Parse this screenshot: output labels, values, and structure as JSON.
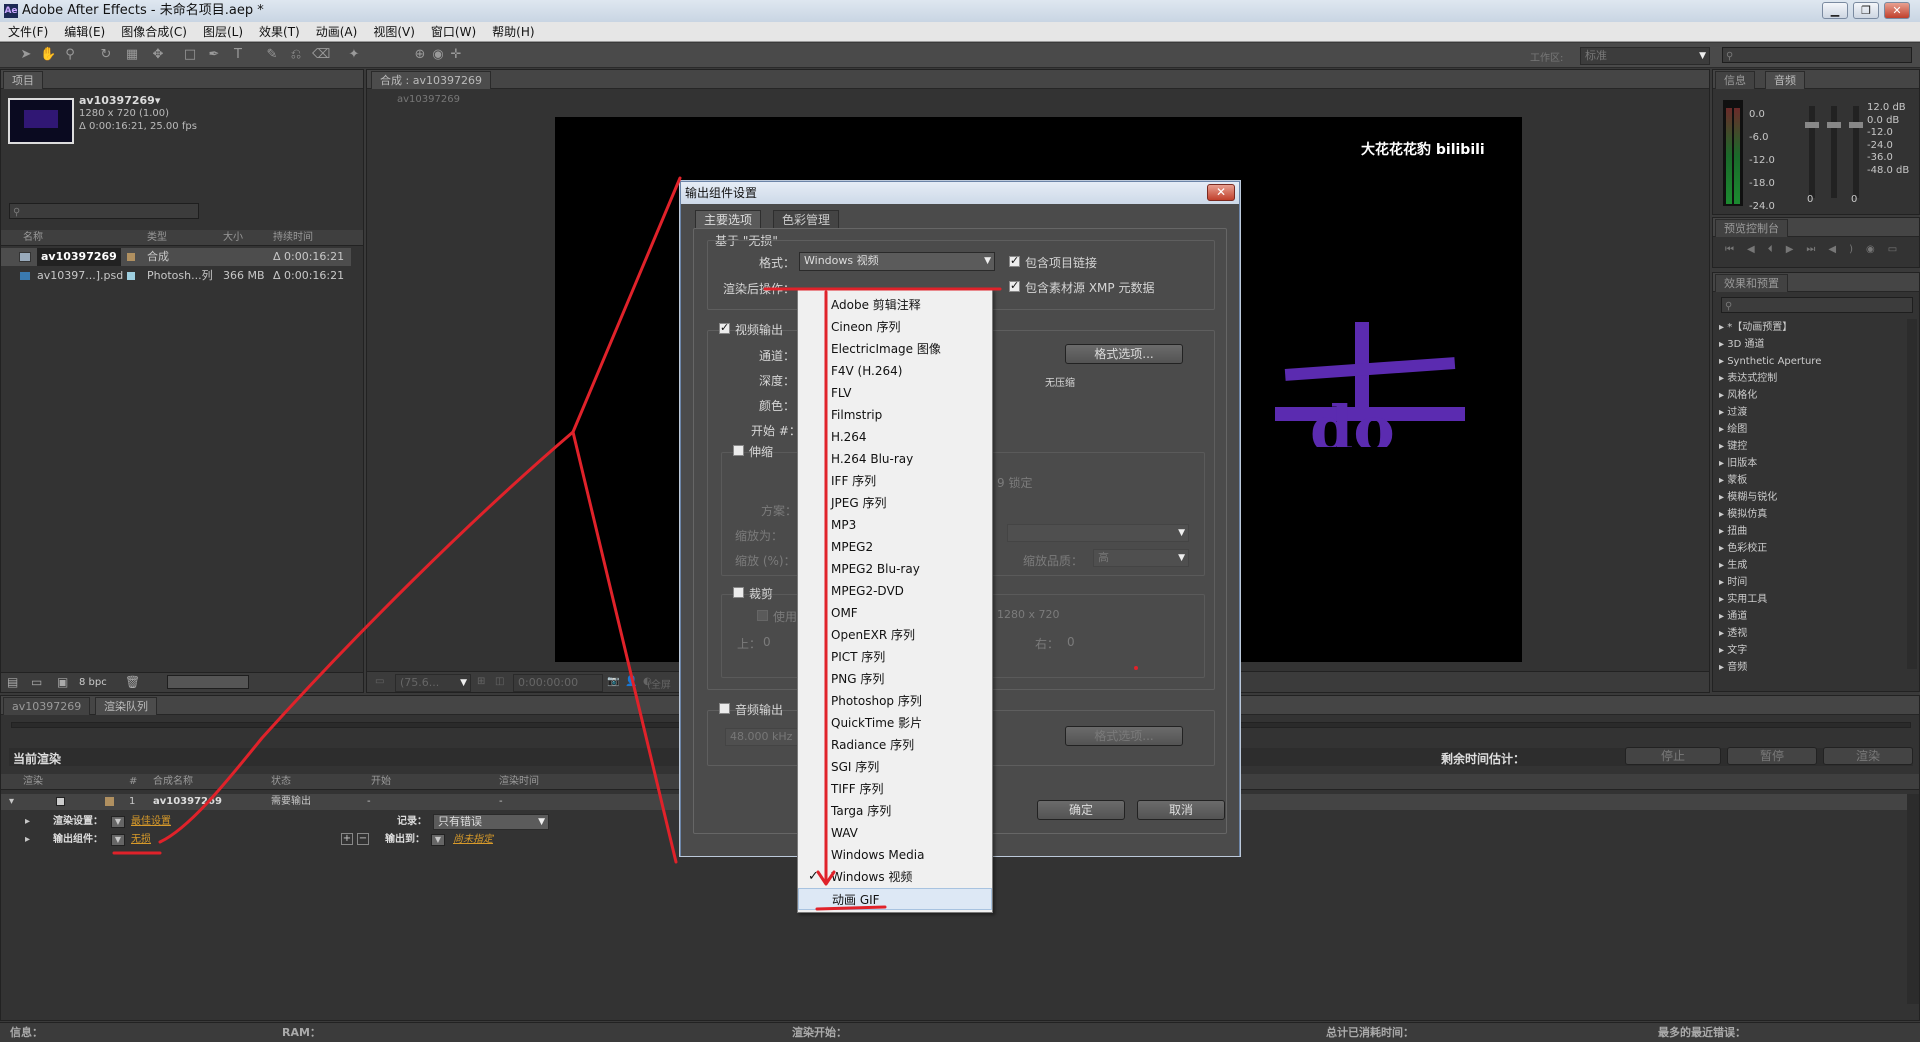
{
  "window": {
    "title": "Adobe After Effects - 未命名项目.aep *"
  },
  "menu": [
    "文件(F)",
    "编辑(E)",
    "图像合成(C)",
    "图层(L)",
    "效果(T)",
    "动画(A)",
    "视图(V)",
    "窗口(W)",
    "帮助(H)"
  ],
  "toolbar": {
    "workspace_label": "工作区:",
    "workspace_value": "标准"
  },
  "project_panel": {
    "tab": "项目",
    "item_name": "av10397269▾",
    "item_size": "1280 x 720 (1.00)",
    "item_duration": "Δ 0:00:16:21, 25.00 fps",
    "columns": [
      "名称",
      "类型",
      "大小",
      "持续时间"
    ],
    "rows": [
      {
        "name": "av10397269",
        "type": "合成",
        "size": "",
        "duration": "Δ 0:00:16:21"
      },
      {
        "name": "av10397...].psd",
        "type": "Photosh...列",
        "size": "366 MB",
        "duration": "Δ 0:00:16:21"
      }
    ],
    "bpc": "8 bpc"
  },
  "comp_panel": {
    "tab": "合成 : av10397269",
    "crumb": "av10397269",
    "watermark": "大花花花豹 bilibili",
    "zoom": "(75.6...",
    "timecode": "0:00:00:00",
    "view_label": "(全屏"
  },
  "info_panel": {
    "tabs": [
      "信息",
      "音频"
    ],
    "db_left": [
      "0.0",
      "-6.0",
      "-12.0",
      "-18.0",
      "-24.0"
    ],
    "db_right": [
      "12.0 dB",
      "0.0 dB",
      "-12.0",
      "-24.0",
      "-36.0",
      "-48.0 dB"
    ],
    "slider_bottom": [
      "0",
      "0"
    ]
  },
  "preview_panel": {
    "tab": "预览控制台"
  },
  "effects_panel": {
    "tab": "效果和预置",
    "items": [
      "*【动画预置】",
      "3D 通道",
      "Synthetic Aperture",
      "表达式控制",
      "风格化",
      "过渡",
      "绘图",
      "键控",
      "旧版本",
      "蒙板",
      "模糊与锐化",
      "模拟仿真",
      "扭曲",
      "色彩校正",
      "生成",
      "时间",
      "实用工具",
      "通道",
      "透视",
      "文字",
      "音频"
    ]
  },
  "render_queue": {
    "tabs": [
      "av10397269",
      "渲染队列"
    ],
    "current_render": "当前渲染",
    "remaining": "剩余时间估计：",
    "buttons": [
      "停止",
      "暂停",
      "渲染"
    ],
    "columns": [
      "渲染",
      "#",
      "合成名称",
      "状态",
      "开始",
      "渲染时间"
    ],
    "row": {
      "num": "1",
      "name": "av10397269",
      "status": "需要输出",
      "start": "-",
      "time": "-"
    },
    "render_settings_label": "渲染设置：",
    "render_settings_value": "最佳设置",
    "log_label": "记录：",
    "log_value": "只有错误",
    "output_module_label": "输出组件：",
    "output_module_value": "无损",
    "output_to_label": "输出到：",
    "output_to_value": "尚未指定"
  },
  "status_bar": {
    "info": "信息：",
    "ram": "RAM：",
    "render_start": "渲染开始：",
    "total_time": "总计已消耗时间：",
    "recent_error": "最多的最近错误："
  },
  "dialog": {
    "title": "输出组件设置",
    "tabs": [
      "主要选项",
      "色彩管理"
    ],
    "based_on": "基于 \"无损\"",
    "format_label": "格式：",
    "format_value": "Windows 视频",
    "post_render_label": "渲染后操作：",
    "include_project_link": "包含项目链接",
    "include_xmp": "包含素材源 XMP 元数据",
    "video_output": "视频输出",
    "channels_label": "通道：",
    "depth_label": "深度：",
    "color_label": "颜色：",
    "start_label": "开始 #：",
    "format_options": "格式选项...",
    "no_compress": "无压缩",
    "stretch": "伸缩",
    "method_label": "方案：",
    "stretch_to_label": "缩放为：",
    "stretch_pct_label": "缩放 (%)：",
    "lock_label": "9 锁定",
    "quality_label": "缩放品质：",
    "quality_value": "高",
    "crop": "裁剪",
    "use_label": "使用",
    "crop_size": "1280 x 720",
    "top_label": "上：",
    "top_value": "0",
    "right_label": "右：",
    "right_value": "0",
    "audio_output": "音频输出",
    "audio_rate": "48.000 kHz",
    "audio_format_options": "格式选项...",
    "ok": "确定",
    "cancel": "取消"
  },
  "format_dropdown": {
    "items": [
      "Adobe 剪辑注释",
      "Cineon 序列",
      "ElectricImage 图像",
      "F4V (H.264)",
      "FLV",
      "Filmstrip",
      "H.264",
      "H.264 Blu-ray",
      "IFF 序列",
      "JPEG 序列",
      "MP3",
      "MPEG2",
      "MPEG2 Blu-ray",
      "MPEG2-DVD",
      "OMF",
      "OpenEXR 序列",
      "PICT 序列",
      "PNG 序列",
      "Photoshop 序列",
      "QuickTime 影片",
      "Radiance 序列",
      "SGI 序列",
      "TIFF 序列",
      "Targa 序列",
      "WAV",
      "Windows Media",
      "Windows 视频",
      "动画 GIF"
    ],
    "checked_index": 26,
    "highlighted_index": 27
  },
  "colors": {
    "annotation": "#e0222a",
    "accent_purple": "#5b2bb0",
    "label_yellow": "#d7b34a"
  }
}
